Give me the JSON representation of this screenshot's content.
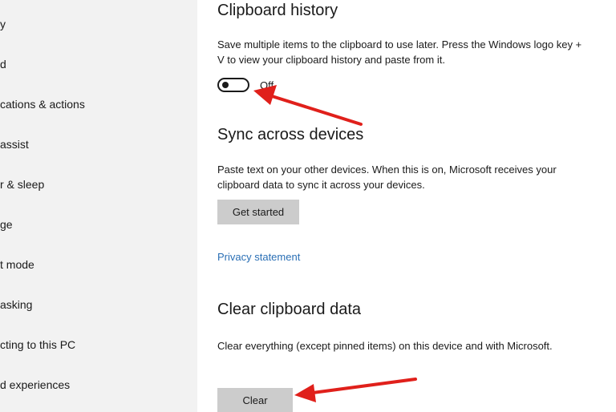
{
  "sidebar": {
    "items": [
      {
        "label": "y"
      },
      {
        "label": "d"
      },
      {
        "label": "cations & actions"
      },
      {
        "label": " assist"
      },
      {
        "label": "r & sleep"
      },
      {
        "label": "ge"
      },
      {
        "label": "t mode"
      },
      {
        "label": "asking"
      },
      {
        "label": "cting to this PC"
      },
      {
        "label": "d experiences"
      }
    ]
  },
  "clipboard_history": {
    "heading": "Clipboard history",
    "description": "Save multiple items to the clipboard to use later. Press the Windows logo key + V to view your clipboard history and paste from it.",
    "toggle_state": "Off"
  },
  "sync": {
    "heading": "Sync across devices",
    "description": "Paste text on your other devices. When this is on, Microsoft receives your clipboard data to sync it across your devices.",
    "button_label": "Get started",
    "privacy_link": "Privacy statement"
  },
  "clear_data": {
    "heading": "Clear clipboard data",
    "description": "Clear everything (except pinned items) on this device and with Microsoft.",
    "button_label": "Clear"
  },
  "colors": {
    "accent_link": "#2a6fb5",
    "arrow": "#e0201b",
    "button_bg": "#cccccc",
    "sidebar_bg": "#f2f2f2"
  }
}
